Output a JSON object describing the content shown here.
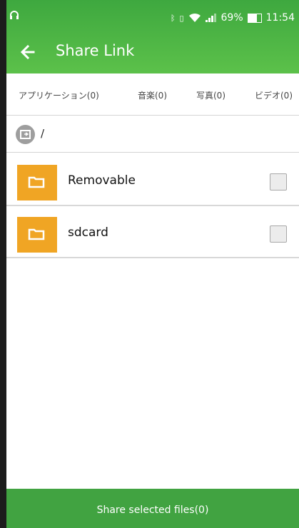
{
  "status": {
    "time": "11:54",
    "battery_text": "69%",
    "battery_level": 0.69
  },
  "header": {
    "title": "Share Link",
    "back_icon": "arrow-left-icon",
    "background": "#4caf50"
  },
  "tabs": [
    {
      "label": "アプリケーション(0)"
    },
    {
      "label": "音楽(0)"
    },
    {
      "label": "写真(0)"
    },
    {
      "label": "ビデオ(0)"
    }
  ],
  "path": {
    "icon": "storage-icon",
    "label": "/"
  },
  "files": [
    {
      "name": "Removable",
      "checked": false,
      "icon": "folder-icon"
    },
    {
      "name": "sdcard",
      "checked": false,
      "icon": "folder-icon"
    }
  ],
  "footer": {
    "button_label": "Share selected files(0)"
  },
  "colors": {
    "accent_green": "#41a341",
    "folder_orange": "#f0a524"
  }
}
